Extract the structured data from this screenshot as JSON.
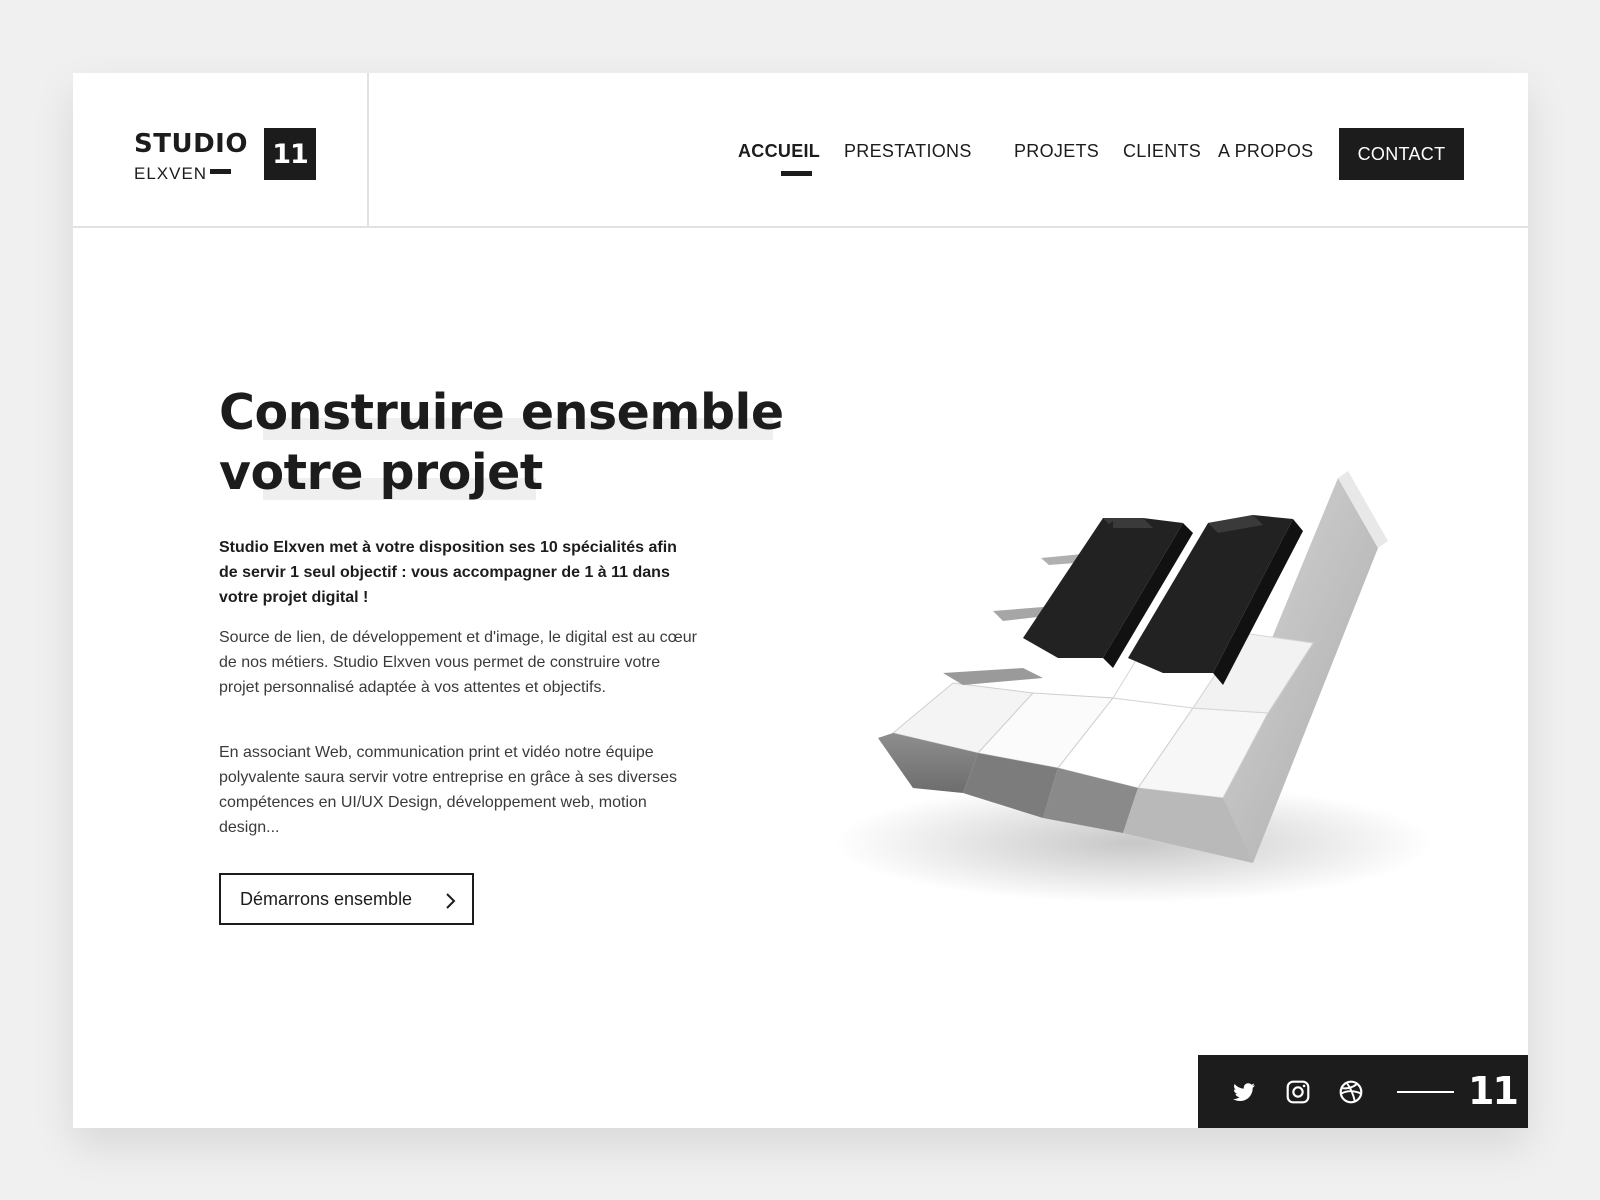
{
  "brand": {
    "line1": "STUDIO",
    "line2": "ELXVEN",
    "badge": "11"
  },
  "nav": {
    "items": [
      {
        "label": "ACCUEIL",
        "active": true
      },
      {
        "label": "PRESTATIONS",
        "active": false
      },
      {
        "label": "PROJETS",
        "active": false
      },
      {
        "label": "CLIENTS",
        "active": false
      },
      {
        "label": "A PROPOS",
        "active": false
      }
    ],
    "contact_label": "CONTACT"
  },
  "hero": {
    "title_line1": "Construire ensemble",
    "title_line2": "votre projet",
    "lead": "Studio Elxven met à votre disposition ses 10 spécialités afin de servir 1 seul objectif : vous accompagner de 1 à 11 dans votre projet digital !",
    "paragraph1": "Source de lien, de développement et d'image, le digital est au cœur de nos métiers. Studio Elxven vous permet de construire votre projet personnalisé adaptée à vos attentes et objectifs.",
    "paragraph2": "En associant Web, communication print et vidéo notre équipe polyvalente saura servir votre entreprise en grâce à ses diverses compétences en UI/UX Design, développement web, motion design...",
    "cta_label": "Démarrons ensemble",
    "cta_icon": "chevron-right-icon"
  },
  "illustration": {
    "subject": "11",
    "icon": "piano-keys-11-illustration"
  },
  "footer_bar": {
    "icons": [
      "twitter-icon",
      "instagram-icon",
      "dribbble-icon"
    ],
    "number": "11"
  },
  "colors": {
    "background": "#f0f0f0",
    "card": "#ffffff",
    "ink": "#1c1c1c",
    "highlight": "#efefef",
    "divider": "#e2e2e2"
  }
}
